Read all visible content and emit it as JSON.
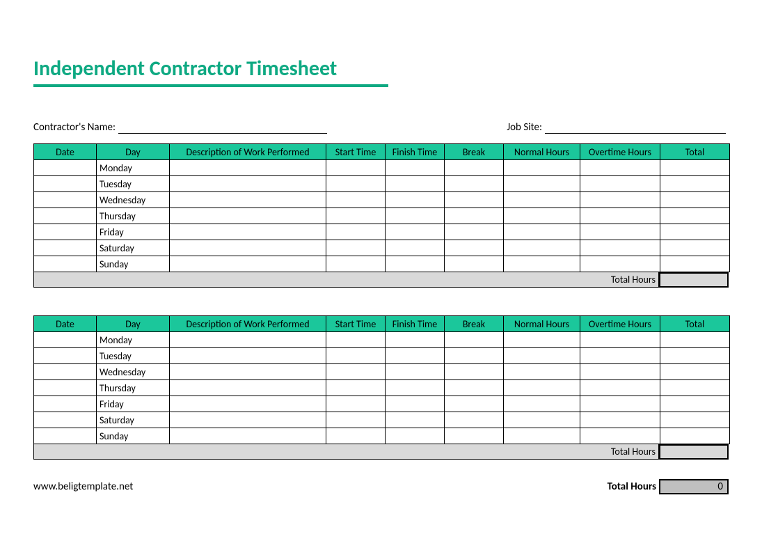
{
  "title": "Independent Contractor Timesheet",
  "fields": {
    "contractor_label": "Contractor's Name:",
    "contractor_value": "",
    "jobsite_label": "Job Site:",
    "jobsite_value": ""
  },
  "columns": [
    "Date",
    "Day",
    "Description of Work Performed",
    "Start Time",
    "Finish Time",
    "Break",
    "Normal Hours",
    "Overtime Hours",
    "Total"
  ],
  "weeks": [
    {
      "rows": [
        {
          "date": "",
          "day": "Monday",
          "desc": "",
          "start": "",
          "finish": "",
          "break": "",
          "normal": "",
          "ot": "",
          "total": ""
        },
        {
          "date": "",
          "day": "Tuesday",
          "desc": "",
          "start": "",
          "finish": "",
          "break": "",
          "normal": "",
          "ot": "",
          "total": ""
        },
        {
          "date": "",
          "day": "Wednesday",
          "desc": "",
          "start": "",
          "finish": "",
          "break": "",
          "normal": "",
          "ot": "",
          "total": ""
        },
        {
          "date": "",
          "day": "Thursday",
          "desc": "",
          "start": "",
          "finish": "",
          "break": "",
          "normal": "",
          "ot": "",
          "total": ""
        },
        {
          "date": "",
          "day": "Friday",
          "desc": "",
          "start": "",
          "finish": "",
          "break": "",
          "normal": "",
          "ot": "",
          "total": ""
        },
        {
          "date": "",
          "day": "Saturday",
          "desc": "",
          "start": "",
          "finish": "",
          "break": "",
          "normal": "",
          "ot": "",
          "total": ""
        },
        {
          "date": "",
          "day": "Sunday",
          "desc": "",
          "start": "",
          "finish": "",
          "break": "",
          "normal": "",
          "ot": "",
          "total": ""
        }
      ],
      "total_label": "Total Hours",
      "total_value": ""
    },
    {
      "rows": [
        {
          "date": "",
          "day": "Monday",
          "desc": "",
          "start": "",
          "finish": "",
          "break": "",
          "normal": "",
          "ot": "",
          "total": ""
        },
        {
          "date": "",
          "day": "Tuesday",
          "desc": "",
          "start": "",
          "finish": "",
          "break": "",
          "normal": "",
          "ot": "",
          "total": ""
        },
        {
          "date": "",
          "day": "Wednesday",
          "desc": "",
          "start": "",
          "finish": "",
          "break": "",
          "normal": "",
          "ot": "",
          "total": ""
        },
        {
          "date": "",
          "day": "Thursday",
          "desc": "",
          "start": "",
          "finish": "",
          "break": "",
          "normal": "",
          "ot": "",
          "total": ""
        },
        {
          "date": "",
          "day": "Friday",
          "desc": "",
          "start": "",
          "finish": "",
          "break": "",
          "normal": "",
          "ot": "",
          "total": ""
        },
        {
          "date": "",
          "day": "Saturday",
          "desc": "",
          "start": "",
          "finish": "",
          "break": "",
          "normal": "",
          "ot": "",
          "total": ""
        },
        {
          "date": "",
          "day": "Sunday",
          "desc": "",
          "start": "",
          "finish": "",
          "break": "",
          "normal": "",
          "ot": "",
          "total": ""
        }
      ],
      "total_label": "Total Hours",
      "total_value": ""
    }
  ],
  "footer": {
    "url": "www.beligtemplate.net",
    "grand_total_label": "Total Hours",
    "grand_total_value": "0"
  },
  "colors": {
    "accent": "#0ea982",
    "header_bg": "#1bc79b",
    "subtotal_bg": "#d9d9d9",
    "grand_bg": "#bfbfbf"
  }
}
